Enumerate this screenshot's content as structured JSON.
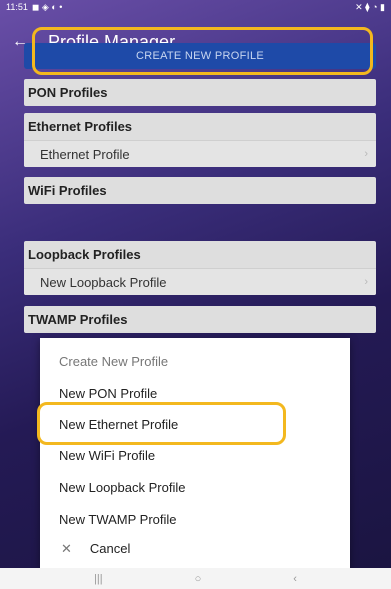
{
  "status": {
    "time": "11:51",
    "left_icons": "◼ ◈ ◐ •",
    "right_icons": "✕ ⧫ ◔ ▮"
  },
  "appbar": {
    "back_icon": "arrow-left-icon",
    "title": "Profile Manager"
  },
  "create_button": {
    "label": "CREATE NEW PROFILE"
  },
  "sections": [
    {
      "header": "PON Profiles",
      "rows": []
    },
    {
      "header": "Ethernet Profiles",
      "rows": [
        "Ethernet Profile"
      ]
    },
    {
      "header": "WiFi Profiles",
      "rows": []
    },
    {
      "header": "Loopback Profiles",
      "rows": [
        "New Loopback Profile"
      ]
    },
    {
      "header": "TWAMP Profiles",
      "rows": []
    }
  ],
  "sheet": {
    "title": "Create New Profile",
    "items": [
      "New PON Profile",
      "New Ethernet Profile",
      "New WiFi Profile",
      "New Loopback Profile",
      "New TWAMP Profile"
    ],
    "cancel_icon": "close-icon",
    "cancel": "Cancel"
  },
  "navbar": {
    "recent": "|||",
    "home": "○",
    "back": "‹"
  },
  "highlight_color": "#f3b81f",
  "accent_color": "#1e4aa8"
}
